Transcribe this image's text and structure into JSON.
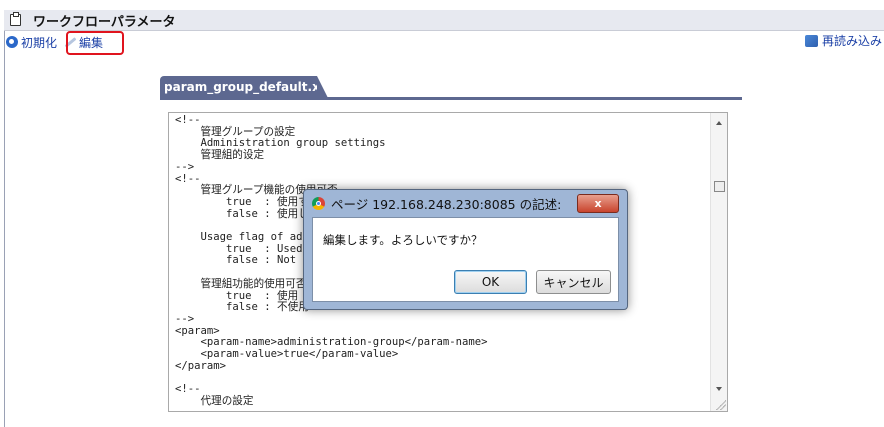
{
  "window": {
    "title": "ワークフローパラメータ"
  },
  "toolbar": {
    "init_label": "初期化",
    "edit_label": "編集",
    "reload_label": "再読み込み"
  },
  "tab": {
    "file_name": "param_group_default.xml"
  },
  "editor": {
    "content": "<!--\n    管理グループの設定\n    Administration group settings\n    管理組的设定\n-->\n<!--\n    管理グループ機能の使用可否\n        true  : 使用する\n        false : 使用しない\n\n    Usage flag of administration group\n        true  : Used\n        false : Not used\n\n    管理組功能的使用可否\n        true  : 使用\n        false : 不使用\n-->\n<param>\n    <param-name>administration-group</param-name>\n    <param-value>true</param-value>\n</param>\n\n<!--\n    代理の設定"
  },
  "dialog": {
    "title": "ページ 192.168.248.230:8085 の記述:",
    "message": "編集します。よろしいですか？",
    "ok_label": "OK",
    "cancel_label": "キャンセル",
    "close_label": "x"
  },
  "colors": {
    "title_bg": "#e7e9f0",
    "tab_bg": "#5d6890",
    "link": "#1a3fa6",
    "highlight": "#e0141e",
    "dialog_frame": "#9fb6d6"
  },
  "icons": {
    "title": "document-icon",
    "init": "refresh-icon",
    "edit": "pencil-icon",
    "reload": "reload-icon",
    "dialog": "chrome-icon"
  }
}
